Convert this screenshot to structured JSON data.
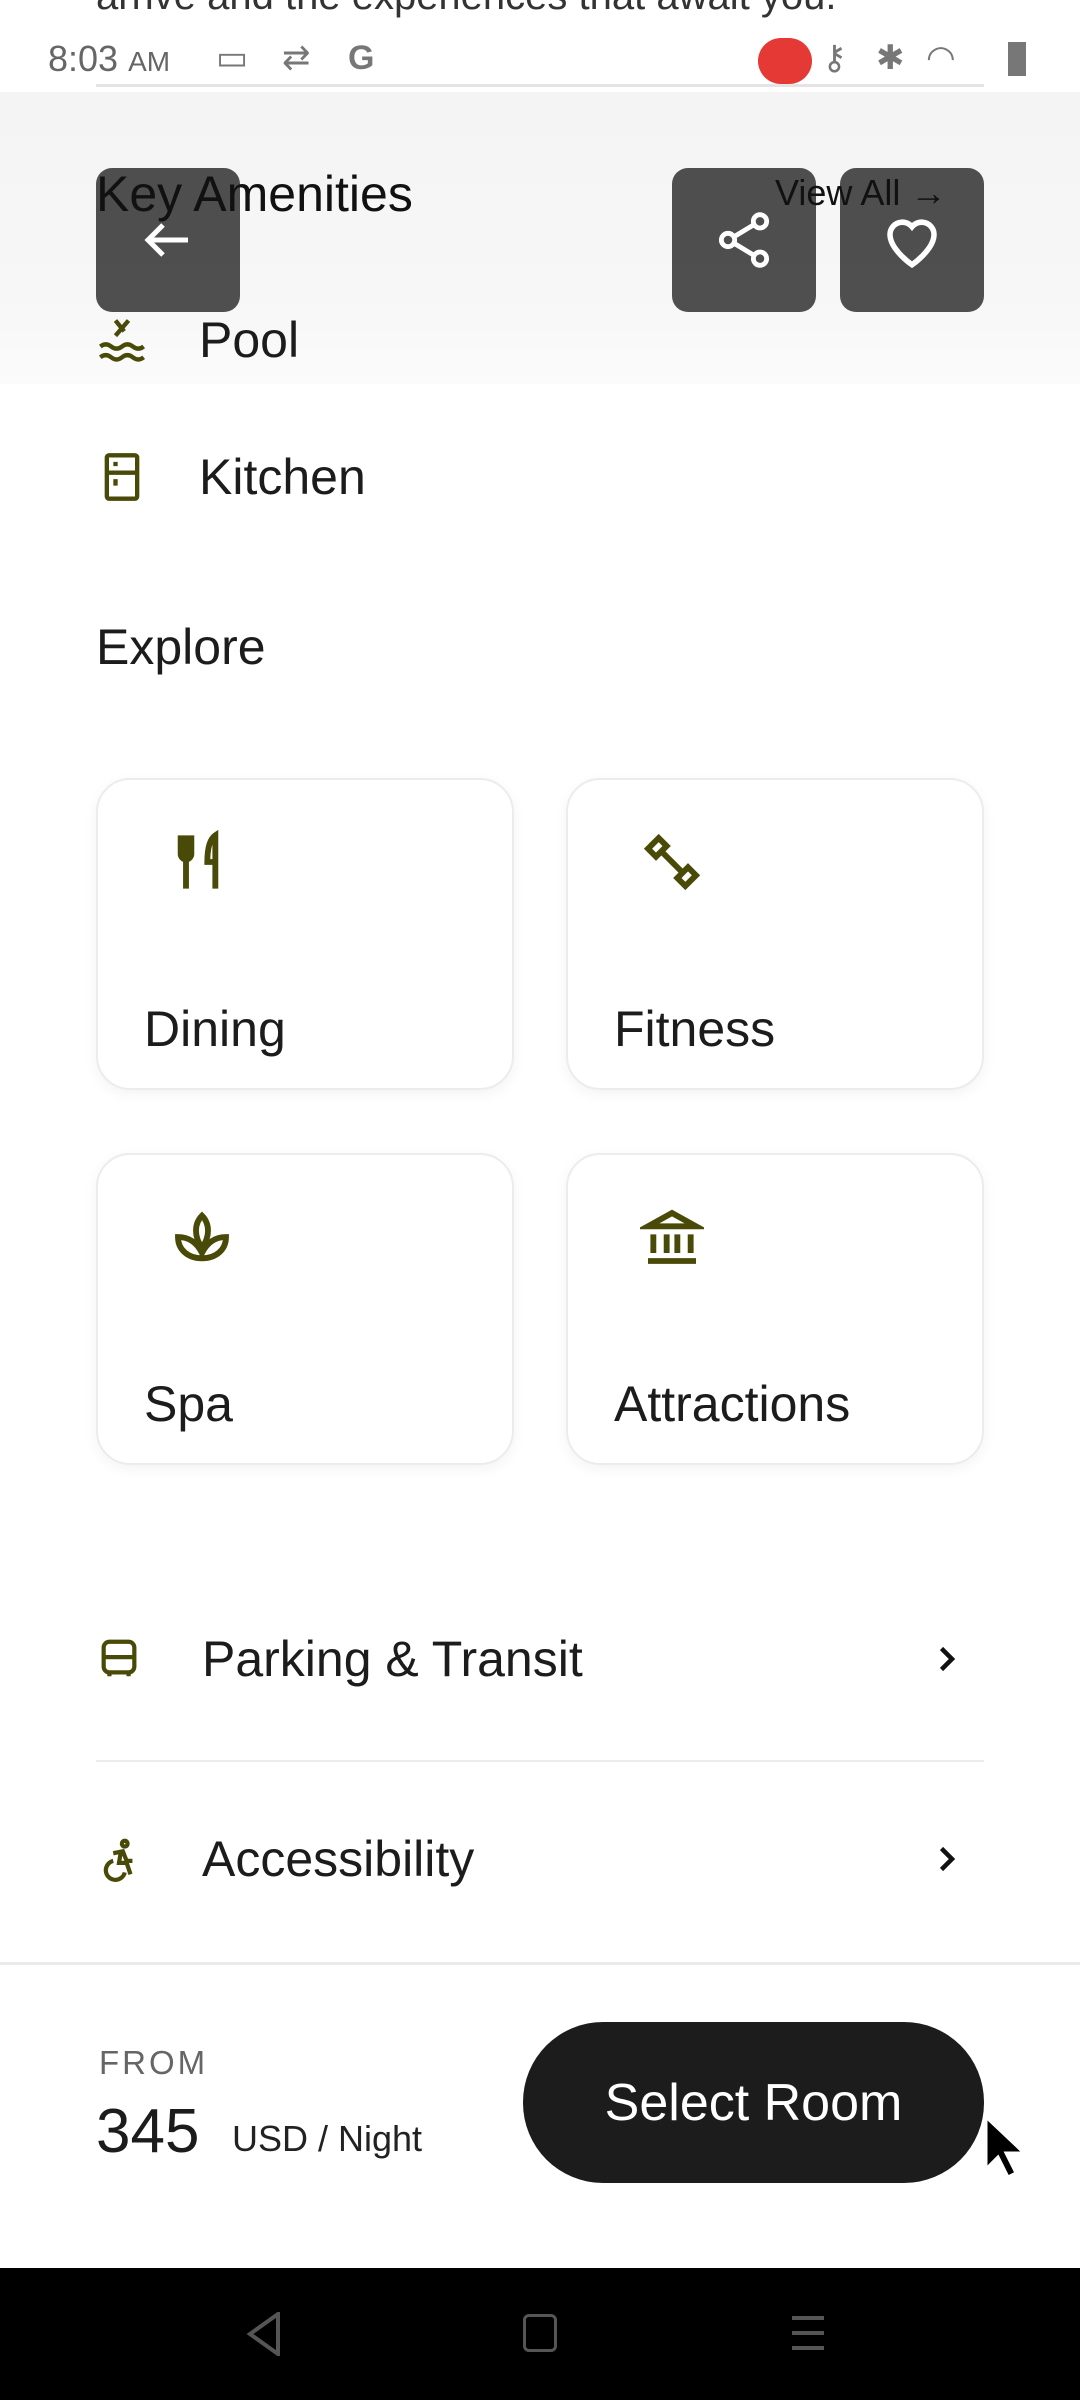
{
  "cut_text": "arrive and the experiences that await you.",
  "status": {
    "time": "8:03",
    "ampm": "AM"
  },
  "header": {
    "title": "Key Amenities",
    "view_all": "View All →"
  },
  "amenities": [
    {
      "label": "Pool",
      "icon": "pool-icon"
    },
    {
      "label": "Kitchen",
      "icon": "kitchen-icon"
    }
  ],
  "explore": {
    "title": "Explore",
    "cards": [
      {
        "label": "Dining",
        "icon": "utensils-icon"
      },
      {
        "label": "Fitness",
        "icon": "dumbbell-icon"
      },
      {
        "label": "Spa",
        "icon": "lotus-icon"
      },
      {
        "label": "Attractions",
        "icon": "museum-icon"
      }
    ]
  },
  "rows": [
    {
      "label": "Parking & Transit",
      "icon": "bus-icon"
    },
    {
      "label": "Accessibility",
      "icon": "accessibility-icon"
    }
  ],
  "footer": {
    "from": "FROM",
    "price": "345",
    "unit": "USD / Night",
    "button": "Select Room"
  },
  "colors": {
    "icon": "#4a4a08",
    "button": "#1c1c1c",
    "recording": "#e53935"
  }
}
